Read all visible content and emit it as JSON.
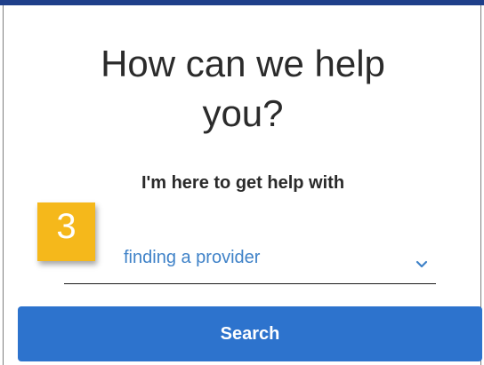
{
  "heading": {
    "line1": "How can we help",
    "line2": "you?"
  },
  "form": {
    "subheading": "I'm here to get help with",
    "step_number": "3",
    "selected_option": "finding a provider",
    "search_label": "Search"
  },
  "colors": {
    "top_bar": "#1f3f8a",
    "badge": "#f5b81b",
    "select_text": "#3f82c8",
    "chevron": "#3f82c8",
    "button": "#2d73cd"
  },
  "icons": {
    "dropdown": "chevron-down-icon"
  }
}
